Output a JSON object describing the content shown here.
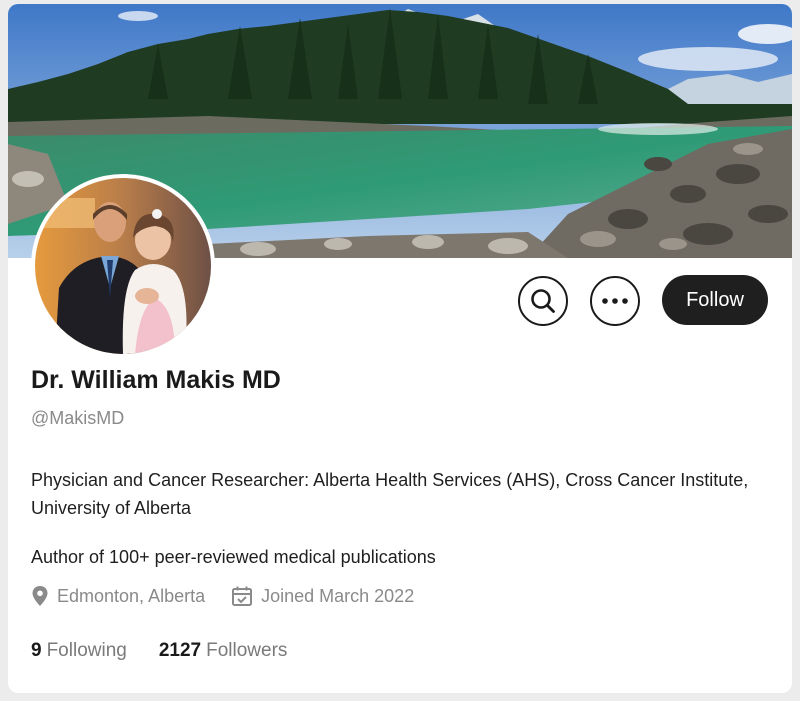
{
  "profile": {
    "name": "Dr. William Makis MD",
    "handle": "@MakisMD",
    "bio_line1": "Physician and Cancer Researcher: Alberta Health Services (AHS), Cross Cancer Institute, University of Alberta",
    "bio_line2": "Author of 100+ peer-reviewed medical publications",
    "location": "Edmonton, Alberta",
    "joined": "Joined March 2022"
  },
  "actions": {
    "follow_label": "Follow",
    "search_icon": "search-icon",
    "more_icon": "more-horizontal-icon"
  },
  "stats": {
    "following_count": "9",
    "following_label": "Following",
    "followers_count": "2127",
    "followers_label": "Followers"
  },
  "colors": {
    "follow_button_bg": "#1f1f1f",
    "muted_text": "#8a8a8a",
    "primary_text": "#1a1a1a"
  },
  "icons": {
    "location": "location-pin-icon",
    "calendar": "calendar-icon"
  }
}
